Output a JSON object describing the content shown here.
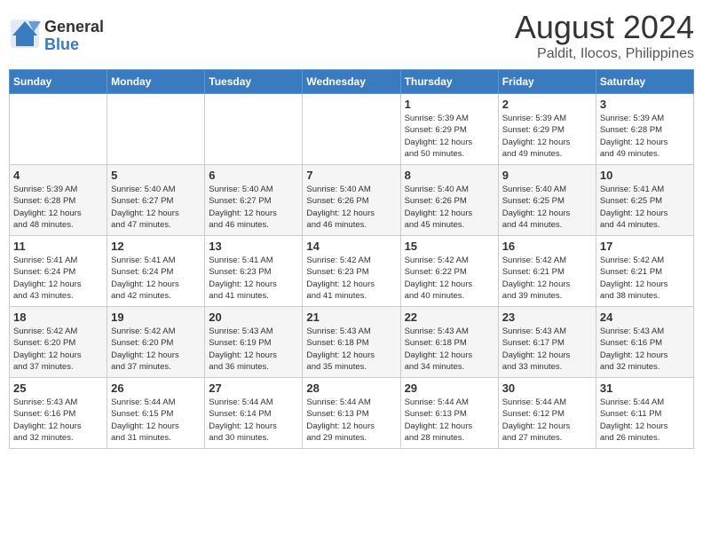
{
  "logo": {
    "general": "General",
    "blue": "Blue"
  },
  "title": "August 2024",
  "subtitle": "Paldit, Ilocos, Philippines",
  "days_header": [
    "Sunday",
    "Monday",
    "Tuesday",
    "Wednesday",
    "Thursday",
    "Friday",
    "Saturday"
  ],
  "weeks": [
    [
      {
        "day": "",
        "info": ""
      },
      {
        "day": "",
        "info": ""
      },
      {
        "day": "",
        "info": ""
      },
      {
        "day": "",
        "info": ""
      },
      {
        "day": "1",
        "info": "Sunrise: 5:39 AM\nSunset: 6:29 PM\nDaylight: 12 hours\nand 50 minutes."
      },
      {
        "day": "2",
        "info": "Sunrise: 5:39 AM\nSunset: 6:29 PM\nDaylight: 12 hours\nand 49 minutes."
      },
      {
        "day": "3",
        "info": "Sunrise: 5:39 AM\nSunset: 6:28 PM\nDaylight: 12 hours\nand 49 minutes."
      }
    ],
    [
      {
        "day": "4",
        "info": "Sunrise: 5:39 AM\nSunset: 6:28 PM\nDaylight: 12 hours\nand 48 minutes."
      },
      {
        "day": "5",
        "info": "Sunrise: 5:40 AM\nSunset: 6:27 PM\nDaylight: 12 hours\nand 47 minutes."
      },
      {
        "day": "6",
        "info": "Sunrise: 5:40 AM\nSunset: 6:27 PM\nDaylight: 12 hours\nand 46 minutes."
      },
      {
        "day": "7",
        "info": "Sunrise: 5:40 AM\nSunset: 6:26 PM\nDaylight: 12 hours\nand 46 minutes."
      },
      {
        "day": "8",
        "info": "Sunrise: 5:40 AM\nSunset: 6:26 PM\nDaylight: 12 hours\nand 45 minutes."
      },
      {
        "day": "9",
        "info": "Sunrise: 5:40 AM\nSunset: 6:25 PM\nDaylight: 12 hours\nand 44 minutes."
      },
      {
        "day": "10",
        "info": "Sunrise: 5:41 AM\nSunset: 6:25 PM\nDaylight: 12 hours\nand 44 minutes."
      }
    ],
    [
      {
        "day": "11",
        "info": "Sunrise: 5:41 AM\nSunset: 6:24 PM\nDaylight: 12 hours\nand 43 minutes."
      },
      {
        "day": "12",
        "info": "Sunrise: 5:41 AM\nSunset: 6:24 PM\nDaylight: 12 hours\nand 42 minutes."
      },
      {
        "day": "13",
        "info": "Sunrise: 5:41 AM\nSunset: 6:23 PM\nDaylight: 12 hours\nand 41 minutes."
      },
      {
        "day": "14",
        "info": "Sunrise: 5:42 AM\nSunset: 6:23 PM\nDaylight: 12 hours\nand 41 minutes."
      },
      {
        "day": "15",
        "info": "Sunrise: 5:42 AM\nSunset: 6:22 PM\nDaylight: 12 hours\nand 40 minutes."
      },
      {
        "day": "16",
        "info": "Sunrise: 5:42 AM\nSunset: 6:21 PM\nDaylight: 12 hours\nand 39 minutes."
      },
      {
        "day": "17",
        "info": "Sunrise: 5:42 AM\nSunset: 6:21 PM\nDaylight: 12 hours\nand 38 minutes."
      }
    ],
    [
      {
        "day": "18",
        "info": "Sunrise: 5:42 AM\nSunset: 6:20 PM\nDaylight: 12 hours\nand 37 minutes."
      },
      {
        "day": "19",
        "info": "Sunrise: 5:42 AM\nSunset: 6:20 PM\nDaylight: 12 hours\nand 37 minutes."
      },
      {
        "day": "20",
        "info": "Sunrise: 5:43 AM\nSunset: 6:19 PM\nDaylight: 12 hours\nand 36 minutes."
      },
      {
        "day": "21",
        "info": "Sunrise: 5:43 AM\nSunset: 6:18 PM\nDaylight: 12 hours\nand 35 minutes."
      },
      {
        "day": "22",
        "info": "Sunrise: 5:43 AM\nSunset: 6:18 PM\nDaylight: 12 hours\nand 34 minutes."
      },
      {
        "day": "23",
        "info": "Sunrise: 5:43 AM\nSunset: 6:17 PM\nDaylight: 12 hours\nand 33 minutes."
      },
      {
        "day": "24",
        "info": "Sunrise: 5:43 AM\nSunset: 6:16 PM\nDaylight: 12 hours\nand 32 minutes."
      }
    ],
    [
      {
        "day": "25",
        "info": "Sunrise: 5:43 AM\nSunset: 6:16 PM\nDaylight: 12 hours\nand 32 minutes."
      },
      {
        "day": "26",
        "info": "Sunrise: 5:44 AM\nSunset: 6:15 PM\nDaylight: 12 hours\nand 31 minutes."
      },
      {
        "day": "27",
        "info": "Sunrise: 5:44 AM\nSunset: 6:14 PM\nDaylight: 12 hours\nand 30 minutes."
      },
      {
        "day": "28",
        "info": "Sunrise: 5:44 AM\nSunset: 6:13 PM\nDaylight: 12 hours\nand 29 minutes."
      },
      {
        "day": "29",
        "info": "Sunrise: 5:44 AM\nSunset: 6:13 PM\nDaylight: 12 hours\nand 28 minutes."
      },
      {
        "day": "30",
        "info": "Sunrise: 5:44 AM\nSunset: 6:12 PM\nDaylight: 12 hours\nand 27 minutes."
      },
      {
        "day": "31",
        "info": "Sunrise: 5:44 AM\nSunset: 6:11 PM\nDaylight: 12 hours\nand 26 minutes."
      }
    ]
  ]
}
